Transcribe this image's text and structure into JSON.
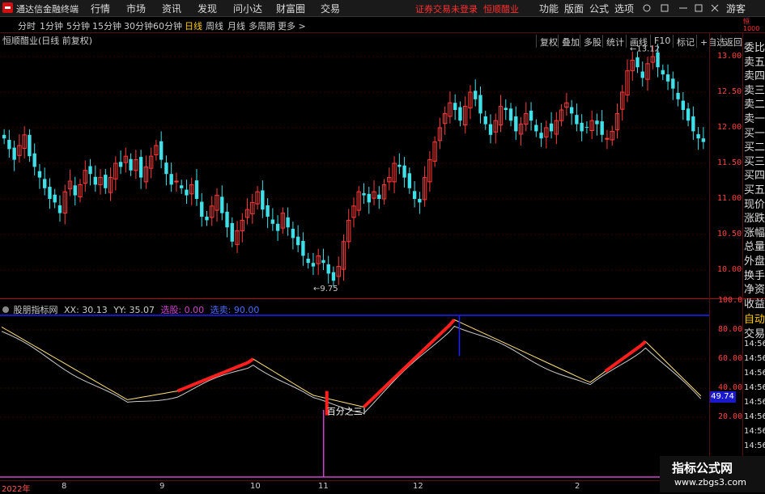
{
  "window": {
    "app_title": "通达信金融终端",
    "trade_status": "证券交易未登录",
    "stock_name": "恒顺醋业"
  },
  "menu": [
    "行情",
    "市场",
    "资讯",
    "发现",
    "问小达",
    "财富圈",
    "交易"
  ],
  "right_menu": [
    "功能",
    "版面",
    "公式",
    "选项",
    "游客"
  ],
  "periods": [
    "分时",
    "1分钟",
    "5分钟",
    "15分钟",
    "30分钟",
    "60分钟",
    "日线",
    "周线",
    "月线",
    "多周期",
    "更多 >"
  ],
  "active_period": "日线",
  "tools": [
    "复权",
    "叠加",
    "多股",
    "统计",
    "画线",
    "F10",
    "标记",
    "+自选",
    "返回"
  ],
  "stock_title": "恒顺醋业(日线 前复权)",
  "price_axis": [
    "13.00",
    "12.50",
    "12.00",
    "11.50",
    "11.00",
    "10.50",
    "10.00"
  ],
  "price_high_label": "13.12",
  "price_low_label": "9.75",
  "indicator": {
    "name": "股朋指标网",
    "xx_label": "XX: 30.13",
    "yy_label": "YY: 35.07",
    "sel_label": "选股: 0.00",
    "sell_label": "选卖: 90.00",
    "axis": [
      "100.0",
      "80.00",
      "60.00",
      "40.00",
      "20.00"
    ],
    "current_value": "49.74",
    "annotation": "百分之三!"
  },
  "right_panel": [
    "委比",
    "卖五",
    "卖四",
    "卖三",
    "卖二",
    "卖一",
    "买一",
    "买二",
    "买三",
    "买四",
    "买五",
    "现价",
    "涨跌",
    "涨幅",
    "总量",
    "外盘",
    "换手",
    "净资",
    "收益"
  ],
  "right_bottom": [
    "自动",
    "交易"
  ],
  "time_list": [
    "14:56",
    "14:56",
    "14:56",
    "14:56",
    "14:56",
    "14:56",
    "14:56",
    "14:56",
    "14:56",
    "14:56"
  ],
  "x_axis": [
    "2022年",
    "8",
    "9",
    "10",
    "11",
    "12",
    "2"
  ],
  "watermark": {
    "title": "指标公式网",
    "url": "www.zbgs3.com"
  },
  "colors": {
    "up": "#ff3b3b",
    "down": "#3fe0e8",
    "axis": "#aa1111",
    "blue_line": "#2020ff",
    "purple": "#cc44cc"
  },
  "chart_data": {
    "type": "candlestick",
    "ylim": [
      9.5,
      13.3
    ],
    "closes": [
      11.85,
      11.7,
      11.55,
      11.75,
      11.9,
      11.6,
      11.45,
      11.3,
      11.15,
      11.0,
      10.95,
      10.8,
      11.1,
      11.25,
      11.05,
      11.2,
      11.4,
      11.35,
      11.2,
      11.3,
      11.15,
      11.3,
      11.5,
      11.45,
      11.6,
      11.4,
      11.55,
      11.3,
      11.45,
      11.6,
      11.75,
      11.55,
      11.35,
      11.2,
      11.25,
      11.15,
      11.05,
      11.2,
      11.0,
      10.75,
      10.7,
      10.9,
      11.05,
      10.8,
      10.6,
      10.4,
      10.55,
      10.7,
      10.85,
      10.95,
      11.1,
      10.85,
      10.75,
      10.65,
      10.55,
      10.8,
      10.6,
      10.45,
      10.35,
      10.2,
      10.1,
      10.05,
      10.2,
      10.1,
      9.95,
      9.85,
      10.05,
      10.4,
      10.7,
      10.9,
      11.1,
      11.05,
      10.95,
      11.1,
      11.0,
      11.2,
      11.3,
      11.5,
      11.45,
      11.3,
      11.15,
      11.0,
      10.95,
      11.3,
      11.55,
      11.8,
      12.0,
      12.2,
      12.35,
      12.25,
      12.1,
      12.3,
      12.5,
      12.4,
      12.2,
      12.05,
      11.9,
      12.1,
      12.3,
      12.25,
      12.1,
      11.95,
      12.05,
      12.2,
      12.1,
      11.95,
      11.85,
      12.0,
      11.95,
      12.1,
      12.25,
      12.35,
      12.2,
      12.05,
      11.95,
      12.0,
      12.1,
      12.05,
      11.9,
      11.85,
      11.95,
      12.2,
      12.5,
      12.8,
      12.95,
      12.85,
      12.7,
      12.9,
      13.0,
      12.85,
      12.75,
      12.65,
      12.55,
      12.4,
      12.25,
      12.1,
      11.95,
      11.85,
      11.8
    ]
  }
}
